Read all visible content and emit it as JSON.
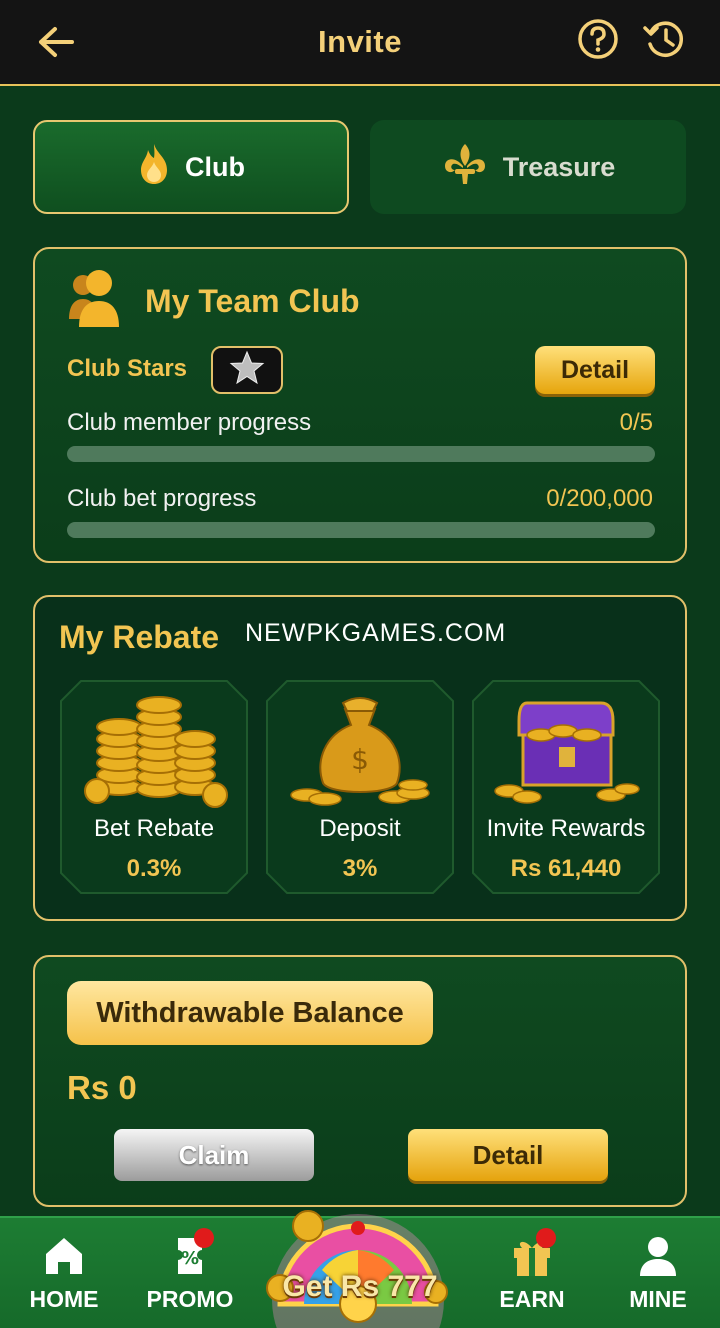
{
  "header": {
    "title": "Invite"
  },
  "tabs": [
    {
      "label": "Club",
      "active": true
    },
    {
      "label": "Treasure",
      "active": false
    }
  ],
  "team_club": {
    "title": "My Team Club",
    "club_stars_label": "Club Stars",
    "detail_label": "Detail",
    "member_progress": {
      "label": "Club member progress",
      "value": "0/5",
      "fraction": 0
    },
    "bet_progress": {
      "label": "Club bet progress",
      "value": "0/200,000",
      "fraction": 0
    }
  },
  "rebate": {
    "title": "My Rebate",
    "watermark": "NEWPKGAMES.COM",
    "items": [
      {
        "label": "Bet Rebate",
        "value": "0.3%",
        "icon": "coin-stack-icon"
      },
      {
        "label": "Deposit",
        "value": "3%",
        "icon": "money-bag-icon"
      },
      {
        "label": "Invite Rewards",
        "value": "Rs 61,440",
        "icon": "treasure-chest-icon"
      }
    ]
  },
  "balance": {
    "title": "Withdrawable Balance",
    "amount": "Rs 0",
    "claim_label": "Claim",
    "detail_label": "Detail"
  },
  "nav": {
    "items": [
      {
        "label": "HOME"
      },
      {
        "label": "PROMO"
      },
      {
        "label": "EARN"
      },
      {
        "label": "MINE"
      }
    ],
    "wheel_label": "Get Rs 777"
  },
  "colors": {
    "accent_gold": "#f2c552",
    "background_green": "#0b3a1b",
    "header_black": "#141414",
    "badge_red": "#e01b1b"
  }
}
